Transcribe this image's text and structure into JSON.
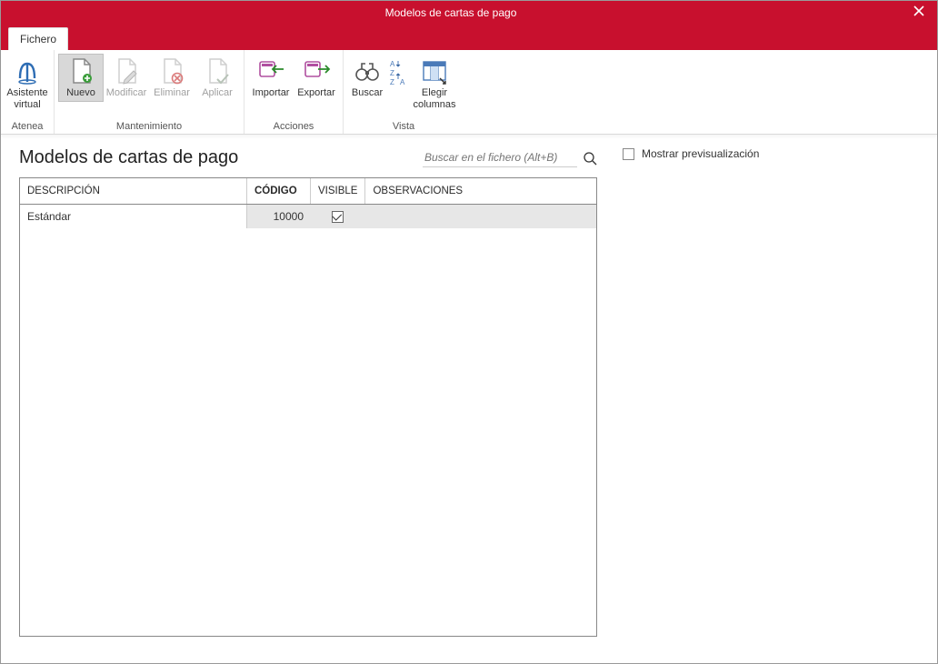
{
  "window": {
    "title": "Modelos de cartas de pago"
  },
  "tabs": {
    "file": "Fichero"
  },
  "ribbon": {
    "groups": {
      "atenea": {
        "label": "Atenea",
        "assistant": "Asistente\nvirtual"
      },
      "maint": {
        "label": "Mantenimiento",
        "new": "Nuevo",
        "modify": "Modificar",
        "delete": "Eliminar",
        "apply": "Aplicar"
      },
      "actions": {
        "label": "Acciones",
        "import": "Importar",
        "export": "Exportar"
      },
      "view": {
        "label": "Vista",
        "find": "Buscar",
        "sort": "",
        "columns": "Elegir\ncolumnas"
      }
    }
  },
  "page": {
    "title": "Modelos de cartas de pago"
  },
  "search": {
    "placeholder": "Buscar en el fichero (Alt+B)"
  },
  "grid": {
    "headers": {
      "desc": "DESCRIPCIÓN",
      "code": "CÓDIGO",
      "visible": "VISIBLE",
      "obs": "OBSERVACIONES"
    },
    "rows": [
      {
        "desc": "Estándar",
        "code": "10000",
        "visible": true,
        "obs": ""
      }
    ]
  },
  "preview": {
    "label": "Mostrar previsualización",
    "checked": false
  }
}
